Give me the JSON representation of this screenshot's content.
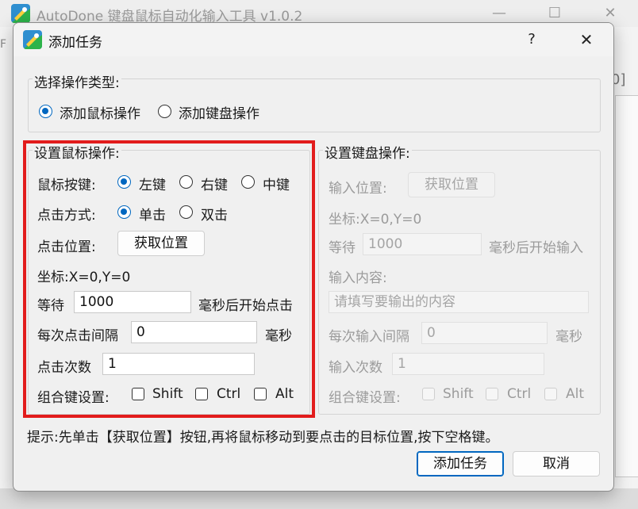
{
  "main_window": {
    "title": "AutoDone 键盘鼠标自动化输入工具 v1.0.2",
    "side_text": "F",
    "right_bracket": "0]"
  },
  "dialog": {
    "title": "添加任务",
    "help": "?",
    "close": "✕"
  },
  "op_type": {
    "title": "选择操作类型:",
    "mouse_option": "添加鼠标操作",
    "keyboard_option": "添加键盘操作",
    "selected": "mouse"
  },
  "mouse": {
    "title": "设置鼠标操作:",
    "button_label": "鼠标按键:",
    "buttons": [
      "左键",
      "右键",
      "中键"
    ],
    "click_label": "点击方式:",
    "click_types": [
      "单击",
      "双击"
    ],
    "position_label": "点击位置:",
    "get_position": "获取位置",
    "coords": "坐标:X=0,Y=0",
    "wait_prefix": "等待",
    "wait_value": "1000",
    "wait_suffix": "毫秒后开始点击",
    "interval_label": "每次点击间隔",
    "interval_value": "0",
    "interval_unit": "毫秒",
    "count_label": "点击次数",
    "count_value": "1",
    "combo_label": "组合键设置:",
    "combo_keys": [
      "Shift",
      "Ctrl",
      "Alt"
    ]
  },
  "keyboard": {
    "title": "设置键盘操作:",
    "position_label": "输入位置:",
    "get_position": "获取位置",
    "coords": "坐标:X=0,Y=0",
    "wait_prefix": "等待",
    "wait_value": "1000",
    "wait_suffix": "毫秒后开始输入",
    "content_label": "输入内容:",
    "content_placeholder": "请填写要输出的内容",
    "interval_label": "每次输入间隔",
    "interval_value": "0",
    "interval_unit": "毫秒",
    "count_label": "输入次数",
    "count_value": "1",
    "combo_label": "组合键设置:",
    "combo_keys": [
      "Shift",
      "Ctrl",
      "Alt"
    ]
  },
  "hint": "提示:先单击【获取位置】按钮,再将鼠标移动到要点击的目标位置,按下空格键。",
  "footer": {
    "add_task": "添加任务",
    "cancel": "取消"
  },
  "colors": {
    "accent": "#0067c0",
    "highlight": "#e21c1c"
  }
}
